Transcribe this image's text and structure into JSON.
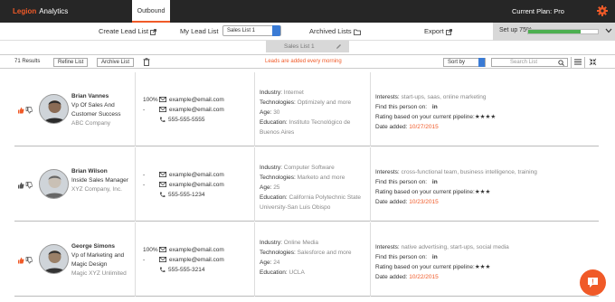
{
  "app": {
    "logo_main": "Legion",
    "logo_sub": "Analytics",
    "active_tab": "Outbound",
    "plan": "Current Plan: Pro"
  },
  "nav": {
    "create": "Create Lead List",
    "mylist": "My Lead List",
    "selected_list": "Sales List 1",
    "archived": "Archived Lists",
    "export": "Export",
    "setup_label": "Set up 75%",
    "setup_progress": 0.75
  },
  "list_tab": "Sales List 1",
  "toolbar": {
    "results": "71 Results",
    "refine": "Refine List",
    "archive": "Archive List",
    "notice": "Leads are added every morning",
    "sort": "Sort by",
    "search_placeholder": "Search List"
  },
  "leads": [
    {
      "name": "Brian Vannes",
      "title": "Vp Of Sales And Customer Success",
      "company": "ABC Company",
      "pct": "100%",
      "email1": "example@email.com",
      "email2": "example@email.com",
      "phone": "555-555-5555",
      "industry": "Internet",
      "technologies": "Optimizely and more",
      "age": "30",
      "education": "Instituto Tecnológico de Buenos Aires",
      "interests": "start-ups, saas, online marketing",
      "date": "10/27/2015"
    },
    {
      "name": "Brian Wilson",
      "title": "Inside Sales Manager",
      "company": "XYZ Company, Inc.",
      "pct": "-",
      "email1": "example@email.com",
      "email2": "example@email.com",
      "phone": "555-555-1234",
      "industry": "Computer Software",
      "technologies": "Marketo and more",
      "age": "25",
      "education": "California Polytechnic State University-San Luis Obispo",
      "interests": "cross-functional team, business intelligence, training",
      "date": "10/23/2015"
    },
    {
      "name": "George Simons",
      "title": "Vp of Marketing and Magic Design",
      "company": "Magic XYZ Unlimited",
      "pct": "100%",
      "email1": "example@email.com",
      "email2": "example@email.com",
      "phone": "555-555-3214",
      "industry": "Online Media",
      "technologies": "Salesforce and more",
      "age": "24",
      "education": "UCLA",
      "interests": "native advertising, start-ups, social media",
      "date": "10/22/2015"
    }
  ],
  "labels": {
    "industry": "Industry:",
    "technologies": "Technologies:",
    "age": "Age:",
    "education": "Education:",
    "interests": "Interests:",
    "find": "Find this person on:",
    "linkedin": "in",
    "rating": "Rating based on your current pipeline:",
    "date": "Date added:",
    "dash": "-"
  },
  "ratings": [
    "★★★★",
    "★★★",
    "★★★"
  ],
  "colors": {
    "accent": "#f05a28",
    "topbar": "#262626",
    "progress": "#4caf50",
    "select": "#3a7bd5"
  }
}
